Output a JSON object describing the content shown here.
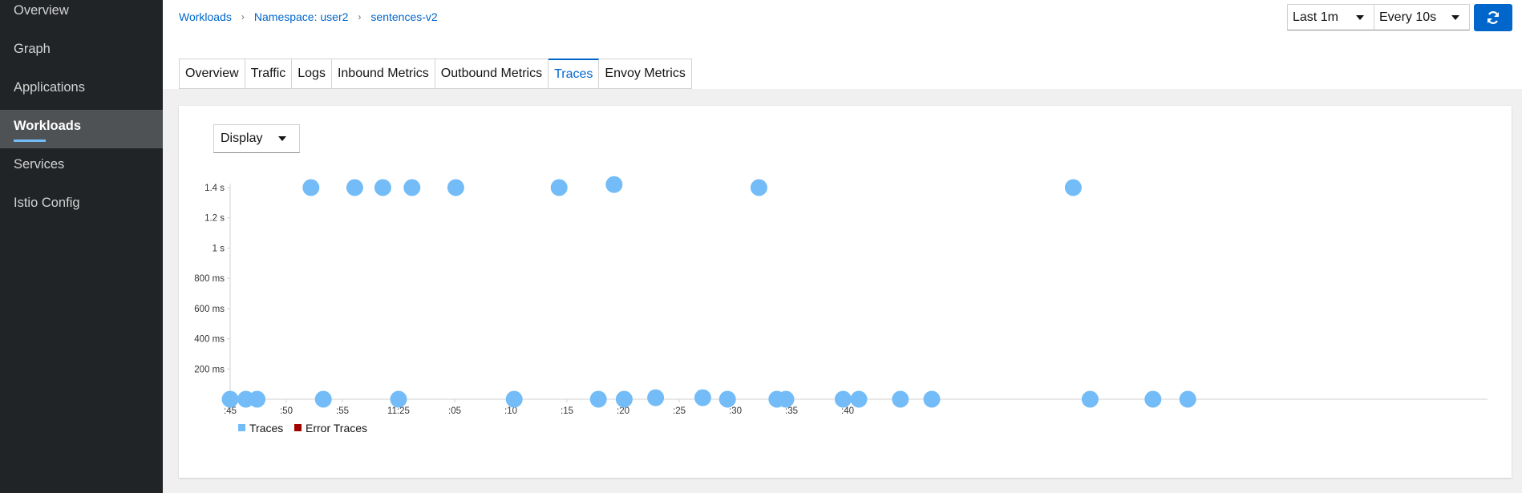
{
  "sidebar": {
    "items": [
      {
        "label": "Overview"
      },
      {
        "label": "Graph"
      },
      {
        "label": "Applications"
      },
      {
        "label": "Workloads"
      },
      {
        "label": "Services"
      },
      {
        "label": "Istio Config"
      }
    ],
    "active_index": 3
  },
  "breadcrumb": [
    "Workloads",
    "Namespace: user2",
    "sentences-v2"
  ],
  "controls": {
    "duration": "Last 1m",
    "refresh_interval": "Every 10s",
    "refresh_icon": "refresh-icon"
  },
  "tabs": [
    "Overview",
    "Traffic",
    "Logs",
    "Inbound Metrics",
    "Outbound Metrics",
    "Traces",
    "Envoy Metrics"
  ],
  "active_tab": "Traces",
  "display_select": "Display",
  "chart_data": {
    "type": "scatter",
    "y_ticks": [
      "1.4 s",
      "1.2 s",
      "1 s",
      "800 ms",
      "600 ms",
      "400 ms",
      "200 ms"
    ],
    "x_ticks": [
      ":45",
      ":50",
      ":55",
      "11:25",
      ":05",
      ":10",
      ":15",
      ":20",
      ":25",
      ":30",
      ":35",
      ":40"
    ],
    "ylim_ms": [
      0,
      1400
    ],
    "legend": [
      {
        "name": "Traces",
        "color": "#73bcf7"
      },
      {
        "name": "Error Traces",
        "color": "#a30000"
      }
    ],
    "series": [
      {
        "name": "Traces",
        "x_seconds": [
          0.0,
          1.4,
          2.4,
          7.2,
          8.3,
          11.1,
          13.6,
          15.0,
          16.2,
          20.1,
          25.3,
          29.3,
          32.8,
          34.2,
          35.1,
          37.9,
          42.1,
          44.3,
          47.1,
          48.7,
          49.5,
          54.6,
          56.0,
          59.7,
          62.5,
          75.1,
          76.6,
          82.2,
          85.3
        ],
        "y_ms": [
          0,
          0,
          0,
          1400,
          0,
          1400,
          1400,
          0,
          1400,
          1400,
          0,
          1400,
          0,
          1420,
          0,
          10,
          10,
          0,
          1400,
          0,
          0,
          0,
          0,
          0,
          0,
          1400,
          0,
          0,
          0
        ]
      }
    ]
  }
}
